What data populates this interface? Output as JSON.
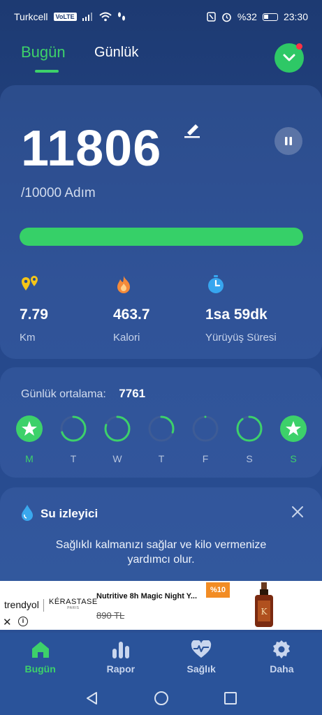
{
  "status_bar": {
    "carrier": "Turkcell",
    "volte": "VoLTE",
    "battery": "%32",
    "time": "23:30"
  },
  "tabs": [
    {
      "label": "Bugün",
      "active": true
    },
    {
      "label": "Günlük",
      "active": false
    }
  ],
  "steps": {
    "count": "11806",
    "goal": "/10000 Adım",
    "progress_fraction": 1.0
  },
  "stats": [
    {
      "icon": "location-pins-icon",
      "value": "7.79",
      "label": "Km"
    },
    {
      "icon": "flame-icon",
      "value": "463.7",
      "label": "Kalori"
    },
    {
      "icon": "stopwatch-icon",
      "value": "1sa 59dk",
      "label": "Yürüyüş Süresi"
    }
  ],
  "weekly": {
    "average_label": "Günlük ortalama:",
    "average_value": "7761",
    "days": [
      {
        "label": "M",
        "progress": 1.0,
        "star": true
      },
      {
        "label": "T",
        "progress": 0.7,
        "star": false
      },
      {
        "label": "W",
        "progress": 0.8,
        "star": false
      },
      {
        "label": "T",
        "progress": 0.3,
        "star": false
      },
      {
        "label": "F",
        "progress": 0.0,
        "star": false
      },
      {
        "label": "S",
        "progress": 0.9,
        "star": false
      },
      {
        "label": "S",
        "progress": 1.0,
        "star": true
      }
    ]
  },
  "water": {
    "title": "Su izleyici",
    "text": "Sağlıklı kalmanızı sağlar ve kilo vermenize yardımcı olur."
  },
  "ad": {
    "store": "trendyol",
    "brand": "KÉRASTASE",
    "brand_sub": "PARIS",
    "title": "Nutritive 8h Magic Night Y...",
    "old_price": "890 TL",
    "badge": "%10"
  },
  "bottom_nav": [
    {
      "label": "Bugün",
      "icon": "home-icon",
      "active": true
    },
    {
      "label": "Rapor",
      "icon": "bar-chart-icon",
      "active": false
    },
    {
      "label": "Sağlık",
      "icon": "heart-pulse-icon",
      "active": false
    },
    {
      "label": "Daha",
      "icon": "gear-icon",
      "active": false
    }
  ],
  "colors": {
    "accent": "#3dd16a",
    "background": "#1d3a72",
    "ad_badge": "#f28c24"
  }
}
